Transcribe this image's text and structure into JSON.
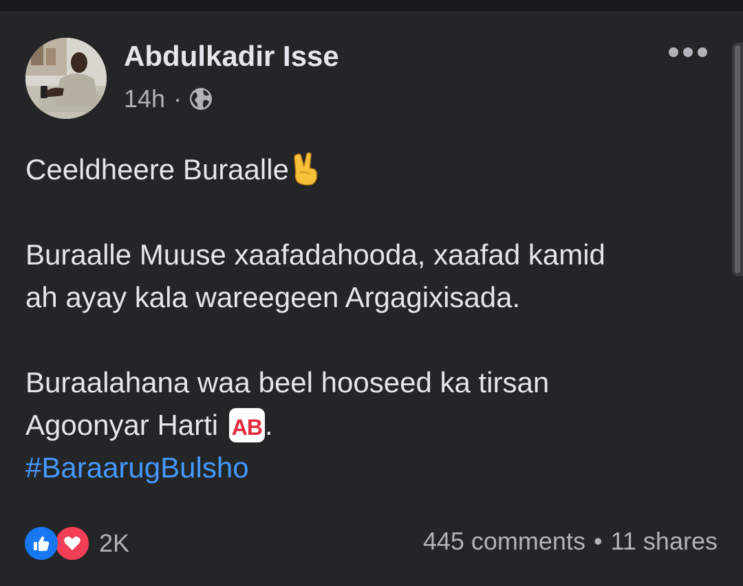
{
  "post": {
    "author": "Abdulkadir Isse",
    "time": "14h",
    "separator": "·",
    "privacy_icon": "globe-icon",
    "more_icon": "more-horizontal-icon",
    "body": {
      "line1": "Ceeldheere Buraalle",
      "line1_emoji": "victory-hand-emoji",
      "line2": "Buraalle Muuse xaafadahooda, xaafad kamid",
      "line3": "ah ayay kala wareegeen Argagixisada.",
      "line4": "Buraalahana waa beel hooseed ka tirsan",
      "line5": "Agoonyar Harti",
      "ab_badge": "AB",
      "line5_end": ".",
      "hashtag": "#BaraarugBulsho"
    }
  },
  "footer": {
    "reaction_icons": [
      "like-reaction-icon",
      "love-reaction-icon"
    ],
    "reaction_count": "2K",
    "comments": "445 comments",
    "bullet": "•",
    "shares": "11 shares"
  },
  "colors": {
    "background": "#242526",
    "text_primary": "#e4e6eb",
    "text_secondary": "#b0b3b8",
    "link": "#4599ff",
    "like": "#1877f2",
    "love": "#f33e58"
  }
}
